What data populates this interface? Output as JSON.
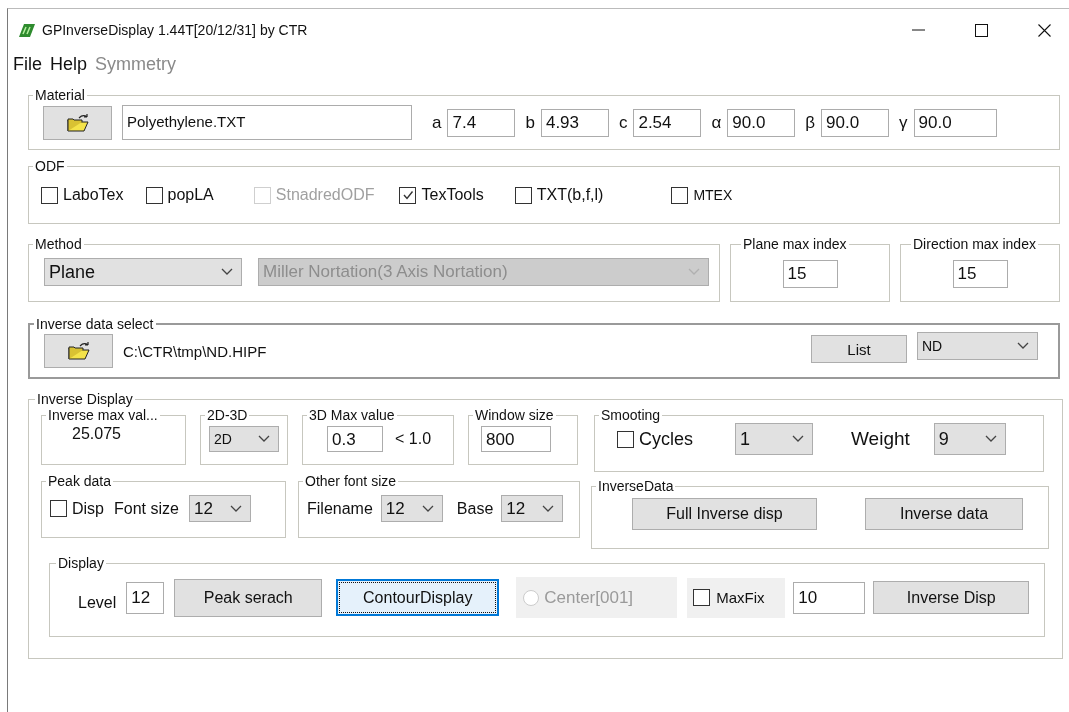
{
  "window": {
    "title": "GPInverseDisplay 1.44T[20/12/31] by CTR"
  },
  "menu": [
    {
      "label": "File",
      "disabled": false
    },
    {
      "label": "Help",
      "disabled": false
    },
    {
      "label": "Symmetry",
      "disabled": true
    }
  ],
  "material": {
    "title": "Material",
    "file": "Polyethylene.TXT",
    "params": [
      {
        "label": "a",
        "value": "7.4"
      },
      {
        "label": "b",
        "value": "4.93"
      },
      {
        "label": "c",
        "value": "2.54"
      },
      {
        "label": "α",
        "value": "90.0"
      },
      {
        "label": "β",
        "value": "90.0"
      },
      {
        "label": "γ",
        "value": "90.0"
      }
    ]
  },
  "odf": {
    "title": "ODF",
    "options": [
      {
        "label": "LaboTex",
        "checked": false,
        "disabled": false
      },
      {
        "label": "popLA",
        "checked": false,
        "disabled": false
      },
      {
        "label": "StnadredODF",
        "checked": false,
        "disabled": true
      },
      {
        "label": "TexTools",
        "checked": true,
        "disabled": false
      },
      {
        "label": "TXT(b,f,l)",
        "checked": false,
        "disabled": false
      },
      {
        "label": "MTEX",
        "checked": false,
        "disabled": false
      }
    ]
  },
  "method": {
    "title": "Method",
    "type": "Plane",
    "notation": "Miller Nortation(3 Axis Nortation)",
    "notation_disabled": true
  },
  "plane_max_index": {
    "title": "Plane max index",
    "value": "15"
  },
  "direction_max_index": {
    "title": "Direction max index",
    "value": "15"
  },
  "inverse_data_select": {
    "title": "Inverse data select",
    "path": "C:\\CTR\\tmp\\ND.HIPF",
    "list_button": "List",
    "axis": "ND"
  },
  "inverse_display": {
    "title": "Inverse Display",
    "inverse_max": {
      "title": "Inverse max val...",
      "value": "25.075"
    },
    "mode": {
      "title": "2D-3D",
      "value": "2D"
    },
    "max_3d": {
      "title": "3D Max value",
      "value": "0.3",
      "limit": "< 1.0"
    },
    "window_size": {
      "title": "Window size",
      "value": "800"
    },
    "smoothing": {
      "title": "Smooting",
      "cycles_label": "Cycles",
      "cycles_checked": false,
      "cycles": "1",
      "weight_label": "Weight",
      "weight": "9"
    },
    "peak_data": {
      "title": "Peak data",
      "disp_label": "Disp",
      "disp_checked": false,
      "font_size_label": "Font size",
      "font_size": "12"
    },
    "other_font_size": {
      "title": "Other font size",
      "filename_label": "Filename",
      "filename": "12",
      "base_label": "Base",
      "base": "12"
    },
    "inverse_data": {
      "title": "InverseData",
      "buttons": [
        "Full Inverse disp",
        "Inverse data"
      ]
    },
    "display": {
      "title": "Display",
      "level_label": "Level",
      "level": "12",
      "peak_button": "Peak serach",
      "contour_button": "ContourDisplay",
      "contour_focused": true,
      "center": {
        "label": "Center[001]",
        "selected": false,
        "disabled": true
      },
      "maxfix_label": "MaxFix",
      "maxfix_checked": false,
      "maxfix_value": "10",
      "inverse_disp_button": "Inverse Disp"
    }
  }
}
